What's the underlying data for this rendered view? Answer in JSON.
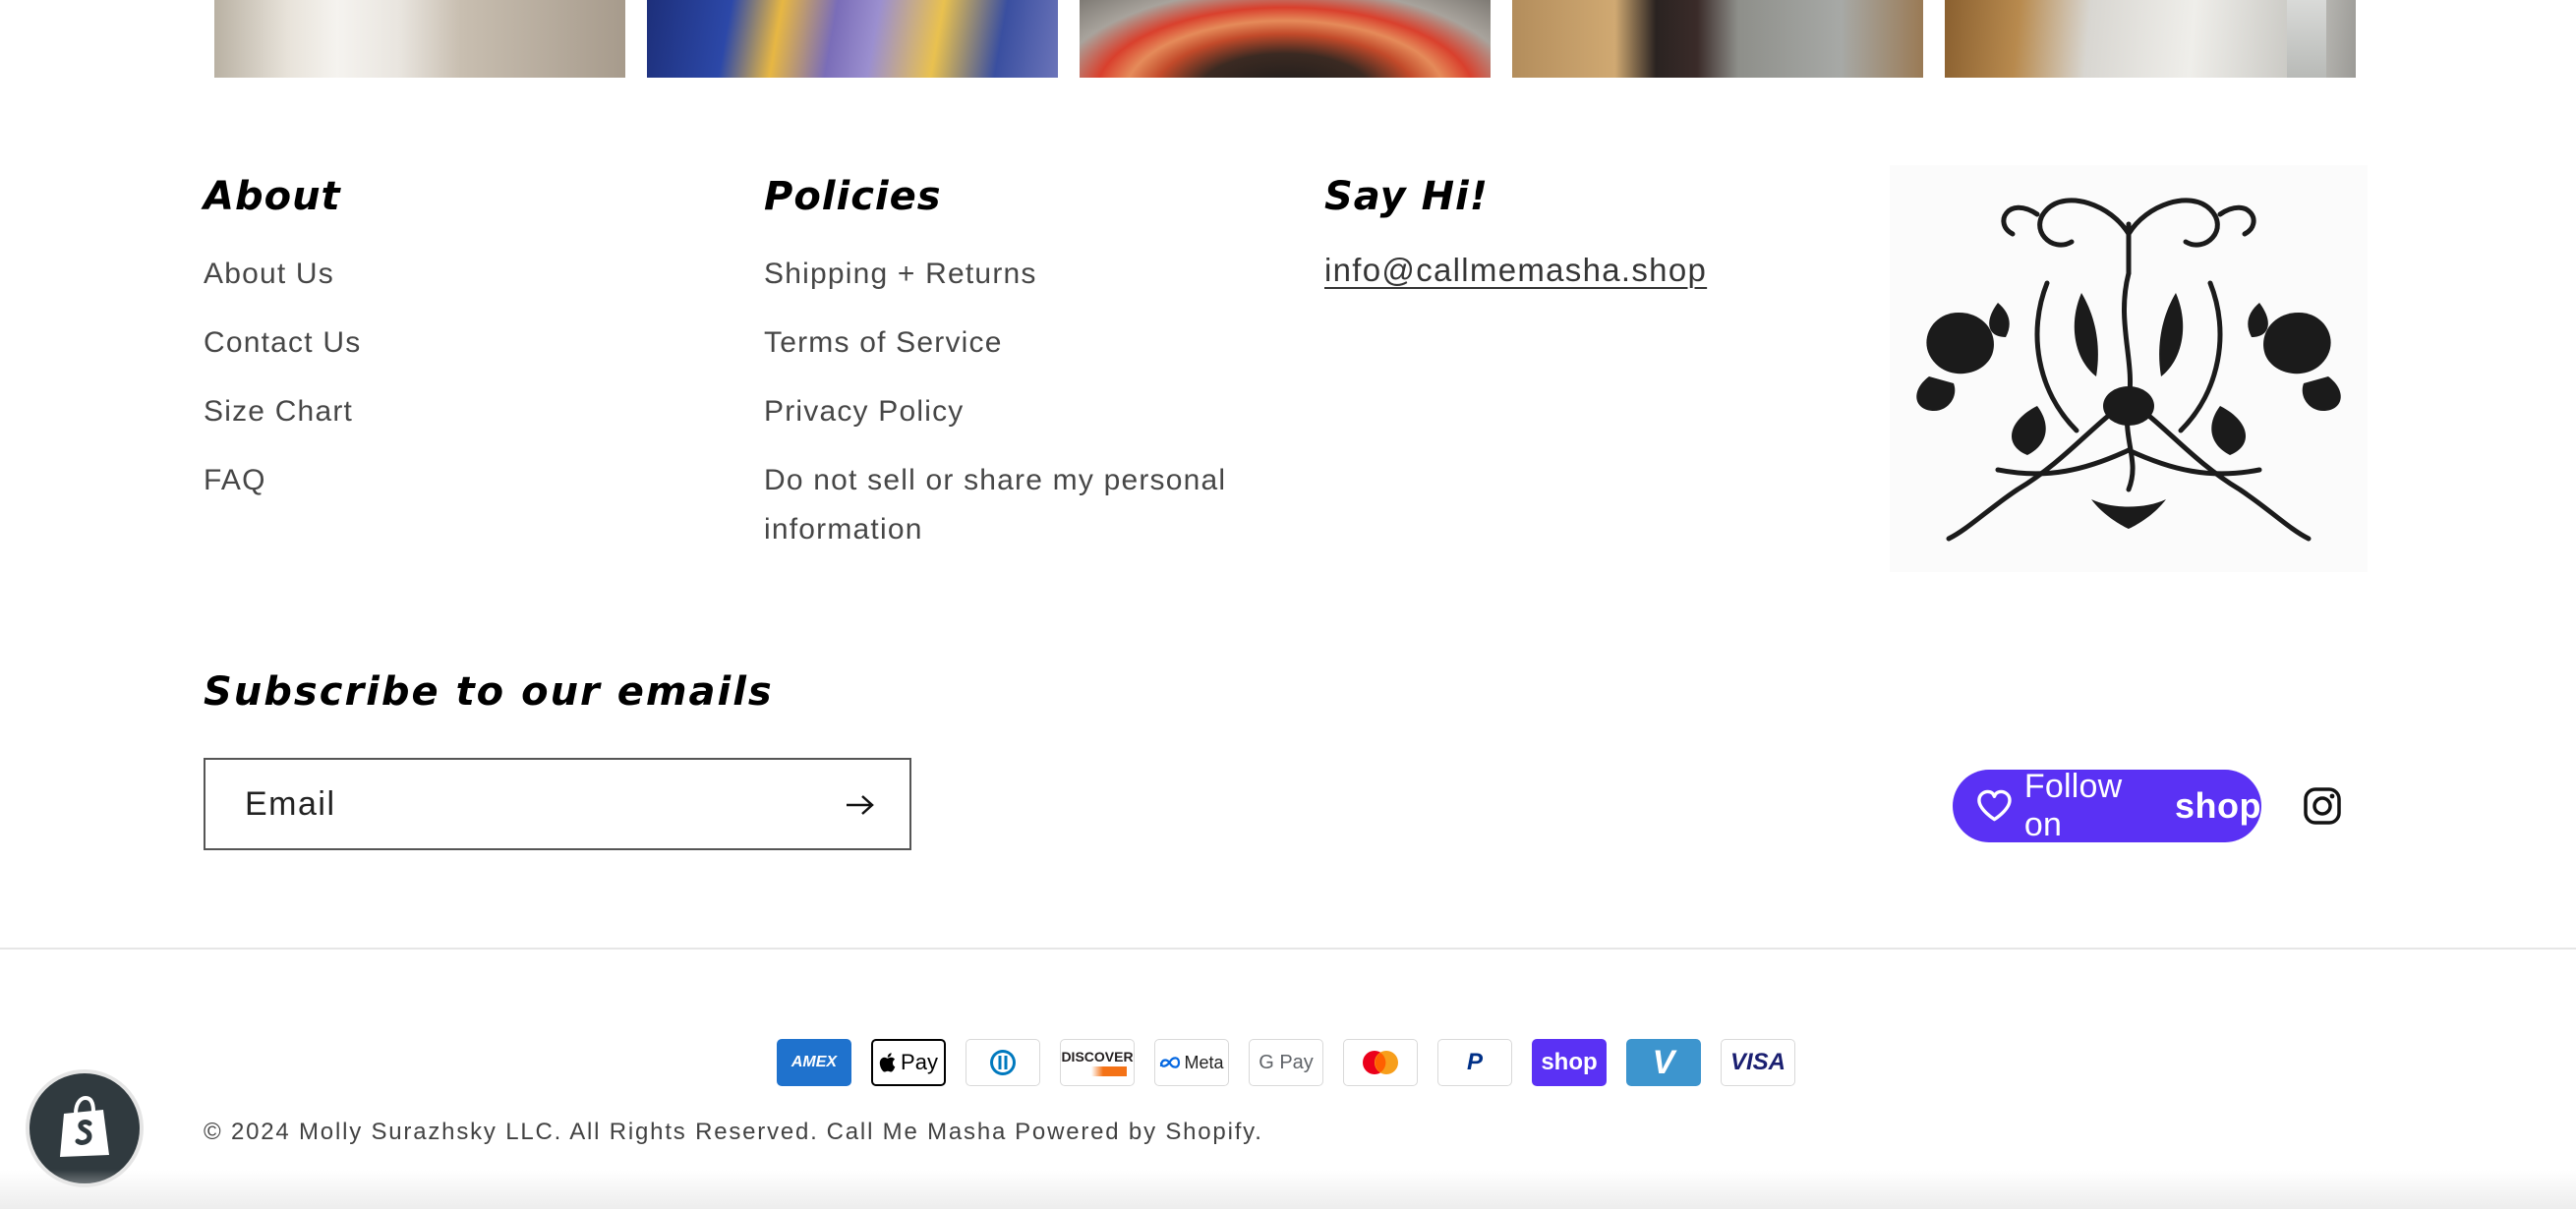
{
  "photo_strip": {
    "images": [
      "photo-1",
      "photo-2",
      "photo-3",
      "photo-4",
      "photo-5"
    ]
  },
  "footer": {
    "about": {
      "heading": "About",
      "links": [
        "About Us",
        "Contact Us",
        "Size Chart",
        "FAQ"
      ]
    },
    "policies": {
      "heading": "Policies",
      "links": [
        "Shipping + Returns",
        "Terms of Service",
        "Privacy Policy",
        "Do not sell or share my personal information"
      ]
    },
    "say_hi": {
      "heading": "Say Hi!",
      "email": "info@callmemasha.shop"
    },
    "ornament_icon": "rose-ornament-icon"
  },
  "subscribe": {
    "heading": "Subscribe to our emails",
    "email_placeholder": "Email",
    "submit_icon": "arrow-right-icon"
  },
  "social": {
    "follow_label": "Follow on",
    "follow_brand": "shop",
    "follow_color": "#5a31f4",
    "instagram_icon": "instagram-icon"
  },
  "payments": [
    "American Express",
    "Apple Pay",
    "Diners Club",
    "Discover",
    "Meta Pay",
    "Google Pay",
    "Mastercard",
    "PayPal",
    "Shop Pay",
    "Venmo",
    "Visa"
  ],
  "payment_labels": {
    "amex": "AMEX",
    "apple": "Pay",
    "discover": "DISCOVER",
    "meta": "Meta",
    "gpay": "G Pay",
    "paypal": "P",
    "shop": "shop",
    "venmo": "V",
    "visa": "VISA"
  },
  "copyright": {
    "text": "© 2024 Molly Surazhsky LLC. All Rights Reserved.",
    "store": "Call Me Masha",
    "powered": "Powered by Shopify."
  },
  "shopify_bubble_icon": "shopify-bag-icon"
}
